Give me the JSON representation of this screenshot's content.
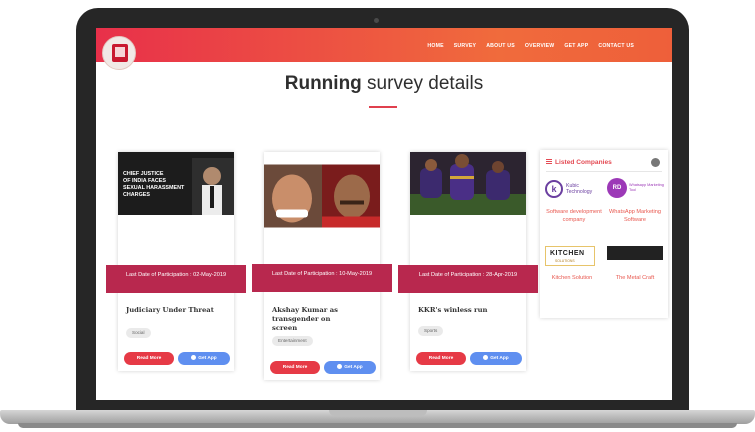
{
  "nav": {
    "items": [
      "HOME",
      "SURVEY",
      "ABOUT US",
      "OVERVIEW",
      "GET APP",
      "CONTACT US"
    ]
  },
  "header": {
    "title_bold": "Running",
    "title_rest": " survey details"
  },
  "cards": [
    {
      "img_text": "CHIEF JUSTICE\nOF INDIA FACES\nSEXUAL HARASSMENT\nCHARGES",
      "ribbon": "Last Date of Participation : 02-May-2019",
      "title": "Judiciary Under Threat",
      "tag": "Social",
      "read_more": "Read More",
      "get_app": "Get App"
    },
    {
      "img_text": "",
      "ribbon": "Last Date of Participation : 10-May-2019",
      "title": "Akshay Kumar as transgender on screen",
      "tag": "Entertainment",
      "read_more": "Read More",
      "get_app": "Get App"
    },
    {
      "img_text": "",
      "ribbon": "Last Date of Participation : 28-Apr-2019",
      "title": "KKR's winless run",
      "tag": "Sports",
      "read_more": "Read More",
      "get_app": "Get App"
    }
  ],
  "panel": {
    "title": "Listed Companies",
    "badge": "",
    "companies": [
      {
        "logo_text": "Kubic Technology",
        "name": "Software development company"
      },
      {
        "logo_text": "Whatsapp Marketing Tool",
        "name": "WhatsApp Marketing Software"
      },
      {
        "logo_text": "KITCHEN",
        "logo_sub": "SOLUTIONS",
        "name": "Kitchen Solution"
      },
      {
        "logo_text": "",
        "name": "The Metal Craft"
      }
    ]
  },
  "colors": {
    "nav_start": "#e8304a",
    "nav_end": "#f06b3c",
    "ribbon": "#b8284e",
    "read_more": "#e63a46",
    "get_app": "#5f8ff0",
    "accent": "#e44b54"
  }
}
